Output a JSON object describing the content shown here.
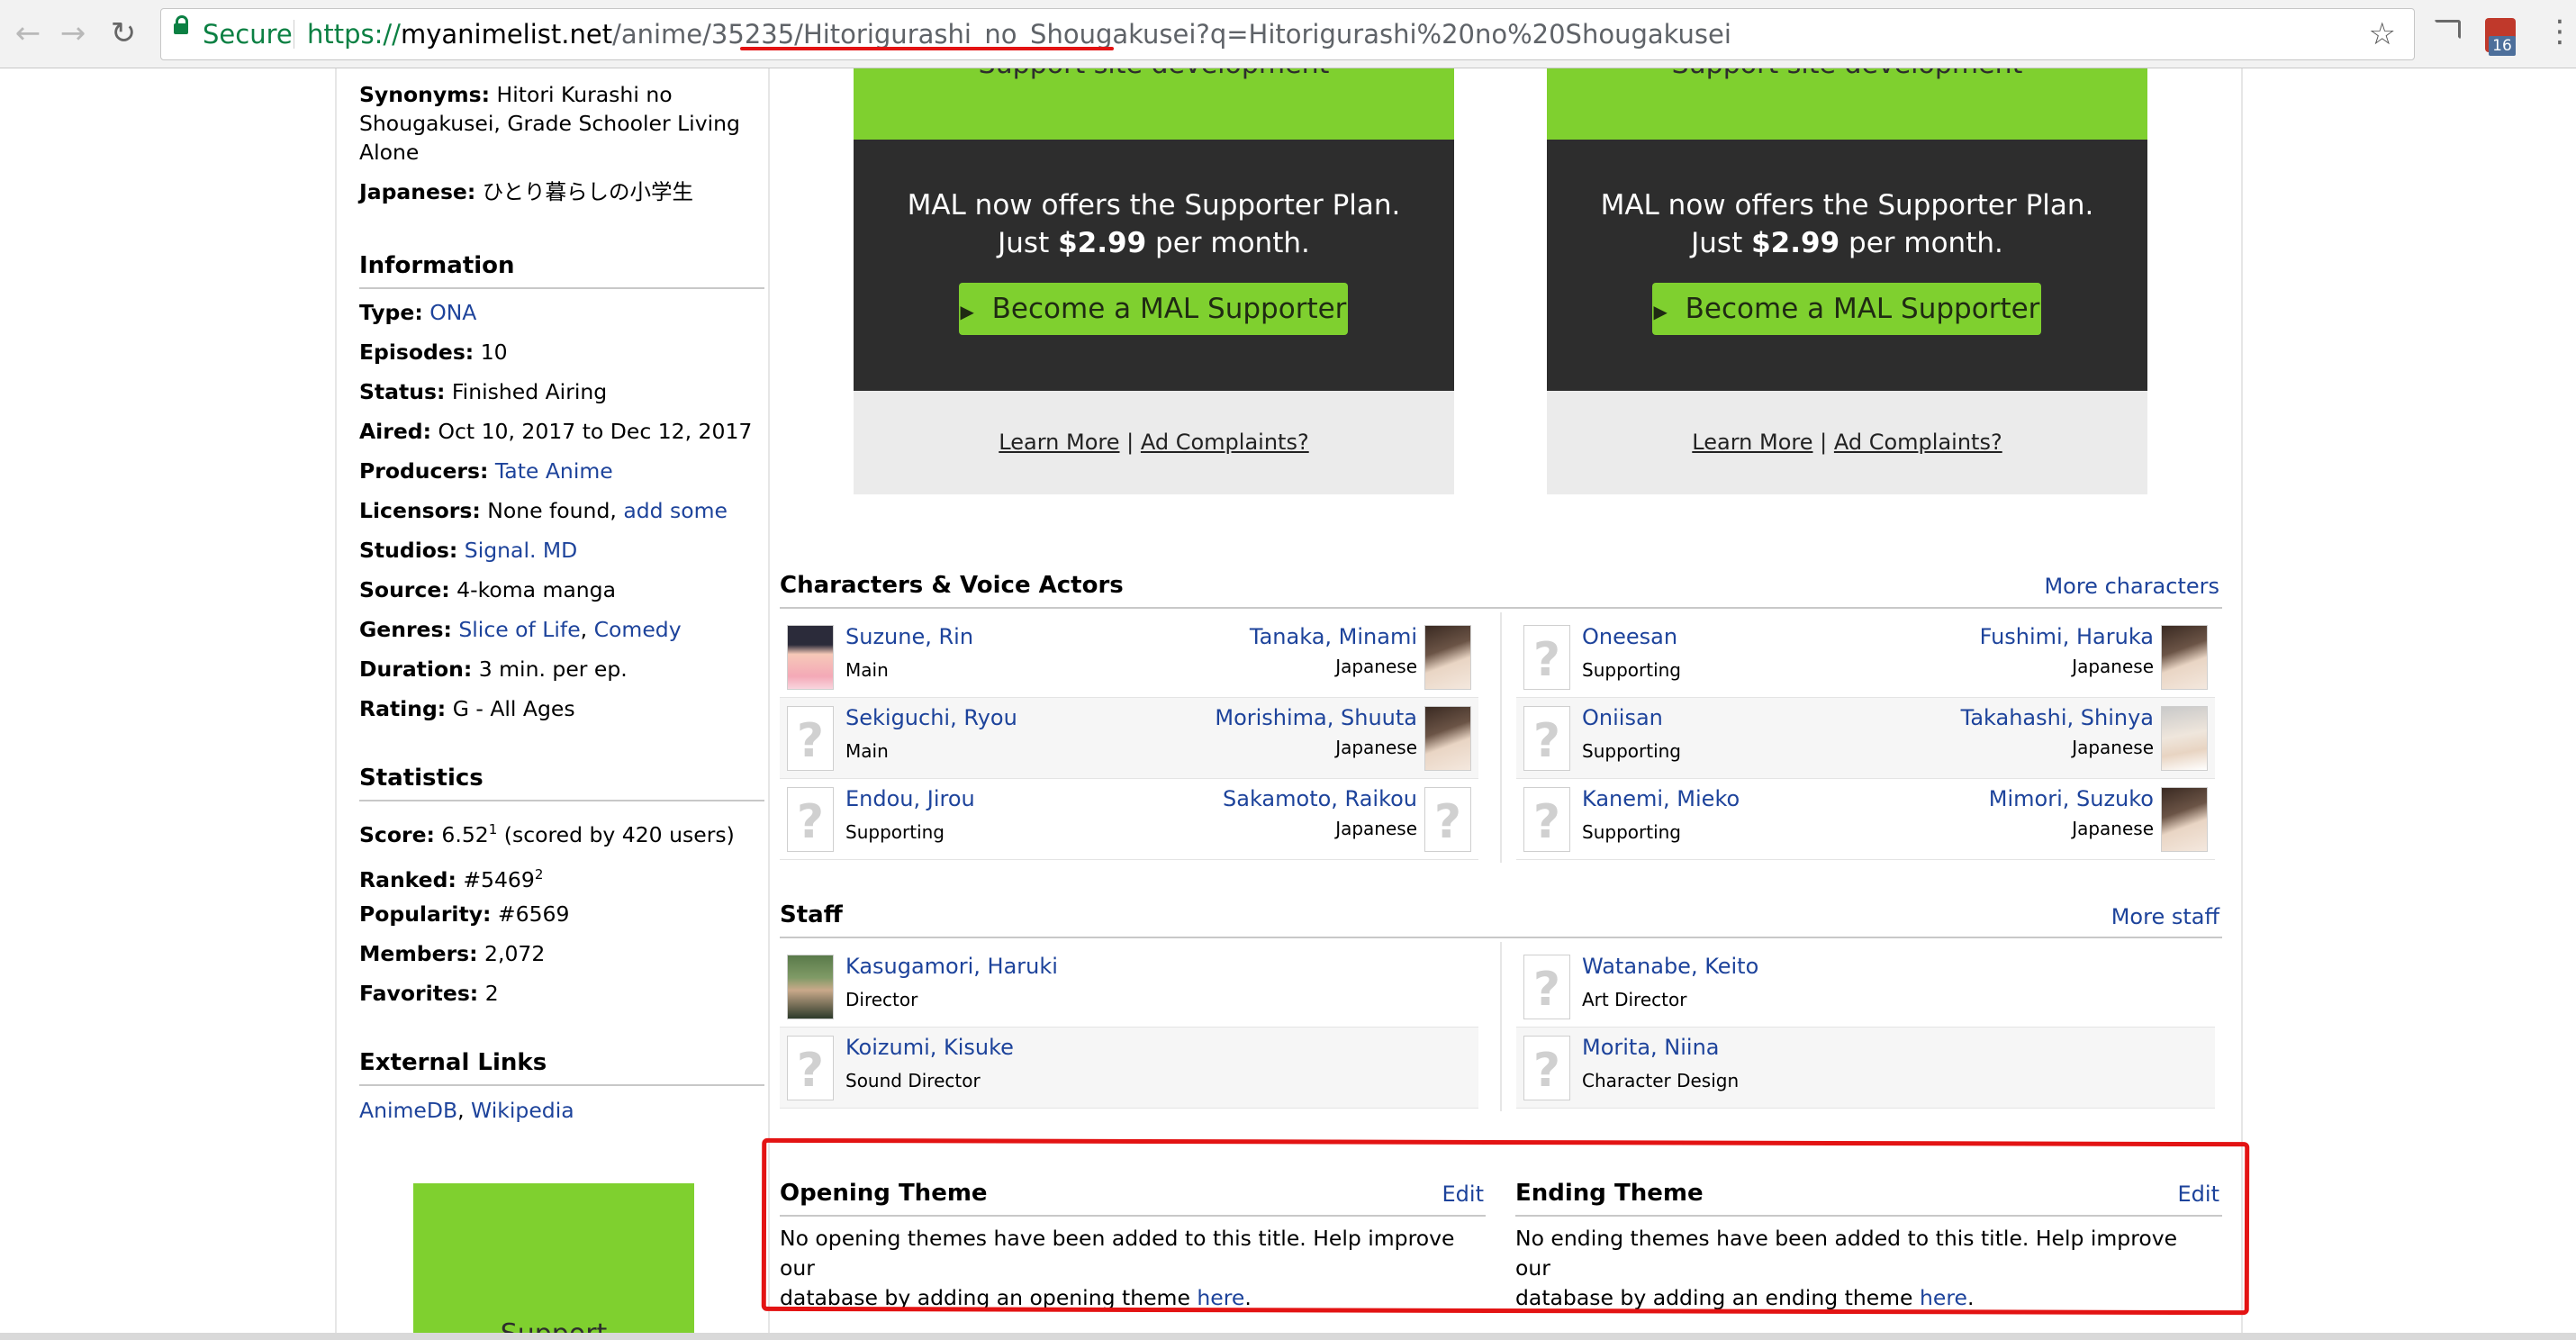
{
  "browser": {
    "secure_label": "Secure",
    "url_scheme": "https://",
    "url_host": "myanimelist.net",
    "url_path": "/anime/35235/Hitorigurashi_no_Shougakusei?q=Hitorigurashi%20no%20Shougakusei",
    "extension_badge": "16"
  },
  "sidebar": {
    "synonyms_label": "Synonyms:",
    "synonyms_lines": [
      "Hitori Kurashi no",
      "Shougakusei, Grade Schooler Living",
      "Alone"
    ],
    "japanese_label": "Japanese:",
    "japanese_value": "ひとり暮らしの小学生",
    "information_heading": "Information",
    "info": [
      {
        "label": "Type:",
        "value": "ONA",
        "link": true
      },
      {
        "label": "Episodes:",
        "value": "10",
        "link": false
      },
      {
        "label": "Status:",
        "value": "Finished Airing",
        "link": false
      },
      {
        "label": "Aired:",
        "value": "Oct 10, 2017 to Dec 12, 2017",
        "link": false
      },
      {
        "label": "Producers:",
        "value": "Tate Anime",
        "link": true
      },
      {
        "label": "Licensors:",
        "value": "None found,",
        "extra_link": "add some"
      },
      {
        "label": "Studios:",
        "value": "Signal. MD",
        "link": true
      },
      {
        "label": "Source:",
        "value": "4-koma manga",
        "link": false
      },
      {
        "label": "Genres:",
        "value": "Slice of Life",
        "sep": ",",
        "extra_link": "Comedy"
      },
      {
        "label": "Duration:",
        "value": "3 min. per ep.",
        "link": false
      },
      {
        "label": "Rating:",
        "value": "G - All Ages",
        "link": false
      }
    ],
    "statistics_heading": "Statistics",
    "stats": {
      "score_label": "Score:",
      "score_value": "6.52",
      "score_sup": "1",
      "score_note": "(scored by 420 users)",
      "ranked_label": "Ranked:",
      "ranked_value": "#5469",
      "ranked_sup": "2",
      "popularity_label": "Popularity:",
      "popularity_value": "#6569",
      "members_label": "Members:",
      "members_value": "2,072",
      "favorites_label": "Favorites:",
      "favorites_value": "2"
    },
    "external_heading": "External Links",
    "external_links": [
      "AnimeDB",
      "Wikipedia"
    ],
    "external_sep": ","
  },
  "ads": {
    "top_text": "Support site development",
    "line1": "MAL now offers the Supporter Plan.",
    "line2_prefix": "Just",
    "line2_price": "$2.99",
    "line2_suffix": "per month.",
    "button_label": "Become a MAL Supporter",
    "learn_more": "Learn More",
    "sep": "|",
    "complaints": "Ad Complaints?",
    "bottom_text": "Support"
  },
  "characters": {
    "title": "Characters & Voice Actors",
    "more": "More characters",
    "left": [
      {
        "name": "Suzune, Rin",
        "role": "Main",
        "va": "Tanaka, Minami",
        "lang": "Japanese"
      },
      {
        "name": "Sekiguchi, Ryou",
        "role": "Main",
        "va": "Morishima, Shuuta",
        "lang": "Japanese"
      },
      {
        "name": "Endou, Jirou",
        "role": "Supporting",
        "va": "Sakamoto, Raikou",
        "lang": "Japanese"
      }
    ],
    "right": [
      {
        "name": "Oneesan",
        "role": "Supporting",
        "va": "Fushimi, Haruka",
        "lang": "Japanese"
      },
      {
        "name": "Oniisan",
        "role": "Supporting",
        "va": "Takahashi, Shinya",
        "lang": "Japanese"
      },
      {
        "name": "Kanemi, Mieko",
        "role": "Supporting",
        "va": "Mimori, Suzuko",
        "lang": "Japanese"
      }
    ]
  },
  "staff": {
    "title": "Staff",
    "more": "More staff",
    "left": [
      {
        "name": "Kasugamori, Haruki",
        "role": "Director"
      },
      {
        "name": "Koizumi, Kisuke",
        "role": "Sound Director"
      }
    ],
    "right": [
      {
        "name": "Watanabe, Keito",
        "role": "Art Director"
      },
      {
        "name": "Morita, Niina",
        "role": "Character Design"
      }
    ]
  },
  "themes": {
    "opening_title": "Opening Theme",
    "ending_title": "Ending Theme",
    "edit": "Edit",
    "opening_text_1": "No opening themes have been added to this title. Help improve our",
    "opening_text_2": "database by adding an opening theme",
    "ending_text_1": "No ending themes have been added to this title. Help improve our",
    "ending_text_2": "database by adding an ending theme",
    "here": "here",
    "period": "."
  },
  "annotation_color": "#e31313",
  "link_color": "#1d439b",
  "accent_green": "#7fd02f"
}
